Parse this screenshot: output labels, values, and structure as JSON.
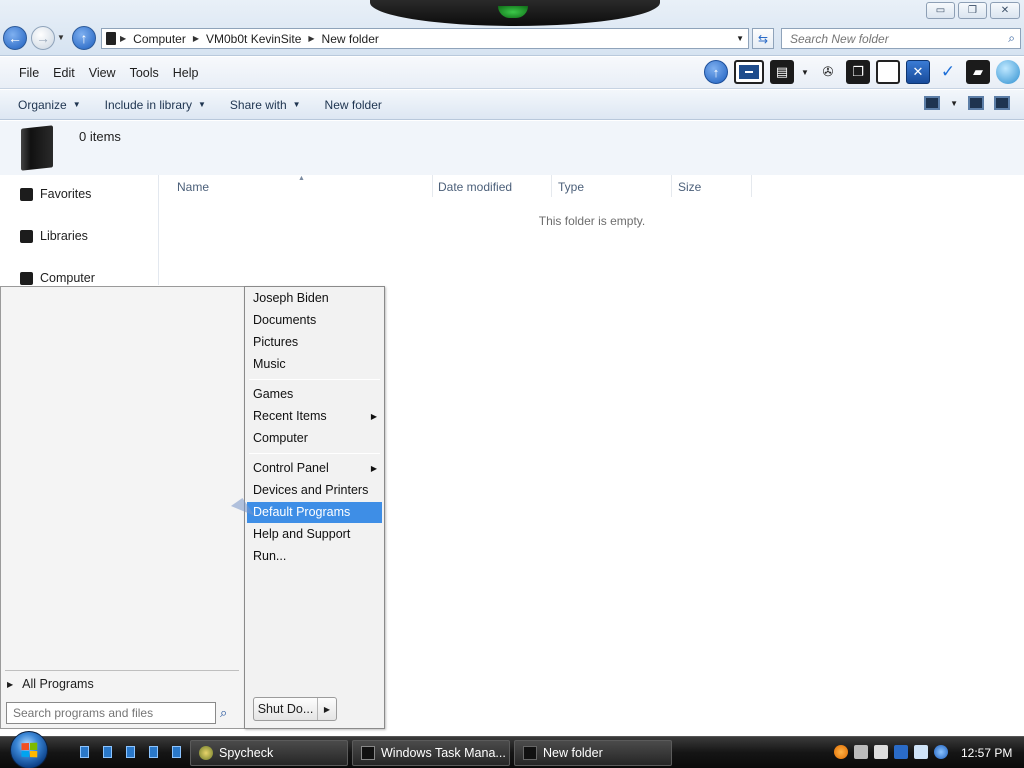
{
  "window": {
    "buttons": {
      "minimize": "▭",
      "restore": "❐",
      "close": "✕"
    }
  },
  "address": {
    "crumbs": [
      "Computer",
      "VM0b0t KevinSite",
      "New folder"
    ]
  },
  "search": {
    "placeholder": "Search New folder"
  },
  "menubar": {
    "items": [
      "File",
      "Edit",
      "View",
      "Tools",
      "Help"
    ]
  },
  "commandbar": {
    "organize": "Organize",
    "include_in_library": "Include in library",
    "share_with": "Share with",
    "new_folder": "New folder"
  },
  "details": {
    "items_count": "0 items"
  },
  "navpane": {
    "items": [
      "Favorites",
      "Libraries",
      "Computer"
    ]
  },
  "filelist": {
    "columns": [
      "Name",
      "Date modified",
      "Type",
      "Size"
    ],
    "empty_message": "This folder is empty."
  },
  "startmenu": {
    "right_items": [
      "Joseph Biden",
      "Documents",
      "Pictures",
      "Music",
      "Games",
      "Recent Items",
      "Computer",
      "Control Panel",
      "Devices and Printers",
      "Default Programs",
      "Help and Support",
      "Run..."
    ],
    "selected_item": "Default Programs",
    "all_programs": "All Programs",
    "search_placeholder": "Search programs and files",
    "shutdown_label": "Shut Do..."
  },
  "taskbar": {
    "buttons": [
      "Spycheck",
      "Windows Task Mana...",
      "New folder"
    ],
    "clock": "12:57 PM"
  },
  "colors": {
    "selection": "#3e8ee6",
    "taskbar": "#151515",
    "explorer_chrome": "#dde7f3"
  }
}
